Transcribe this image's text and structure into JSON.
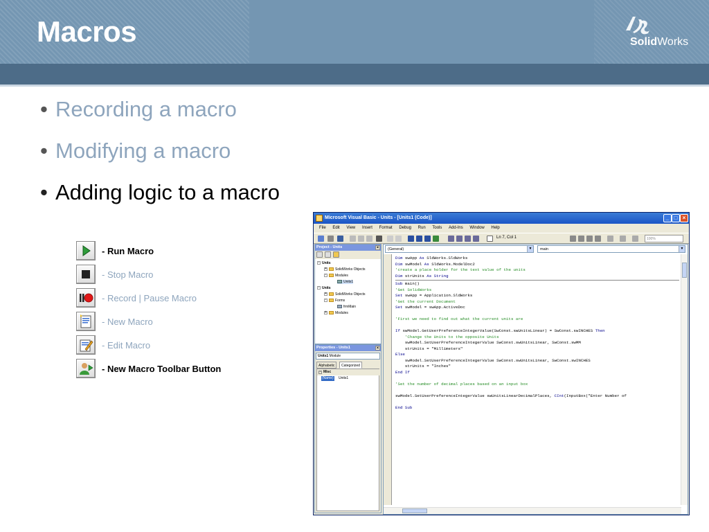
{
  "slide": {
    "title": "Macros",
    "logo_text_bold": "Solid",
    "logo_text_regular": "Works",
    "logo_mark": "3DS"
  },
  "bullets": [
    {
      "text": "Recording a macro",
      "state": "dimmed"
    },
    {
      "text": "Modifying a macro",
      "state": "dimmed"
    },
    {
      "text": "Adding logic to a macro",
      "state": "active"
    }
  ],
  "legend": [
    {
      "icon": "run-macro-icon",
      "label": "- Run Macro",
      "style": "bold"
    },
    {
      "icon": "stop-macro-icon",
      "label": "- Stop Macro",
      "style": "dim"
    },
    {
      "icon": "record-pause-macro-icon",
      "label": "- Record | Pause Macro",
      "style": "dim"
    },
    {
      "icon": "new-macro-icon",
      "label": "- New Macro",
      "style": "dim"
    },
    {
      "icon": "edit-macro-icon",
      "label": "- Edit Macro",
      "style": "dim"
    },
    {
      "icon": "new-macro-toolbar-button-icon",
      "label": "- New Macro Toolbar Button",
      "style": "bold"
    }
  ],
  "vb_window": {
    "title": "Microsoft Visual Basic - Units - [Units1 (Code)]",
    "menu": [
      "File",
      "Edit",
      "View",
      "Insert",
      "Format",
      "Debug",
      "Run",
      "Tools",
      "Add-Ins",
      "Window",
      "Help"
    ],
    "cursor_position": "Ln 7, Col 1",
    "zoom": "100%",
    "project_pane": {
      "title": "Project - Units",
      "tree": [
        {
          "label": "Units",
          "level": 0,
          "bold": true
        },
        {
          "label": "SolidWorks Objects",
          "level": 1
        },
        {
          "label": "Modules",
          "level": 1
        },
        {
          "label": "Units1",
          "level": 2,
          "selected": true
        },
        {
          "label": "Units",
          "level": 0,
          "bold": true
        },
        {
          "label": "SolidWorks Objects",
          "level": 1
        },
        {
          "label": "Forms",
          "level": 1
        },
        {
          "label": "frmMain",
          "level": 2
        },
        {
          "label": "Modules",
          "level": 1
        }
      ]
    },
    "properties_pane": {
      "title": "Properties - Units1",
      "object": "Units1",
      "object_type": "Module",
      "tabs": [
        "Alphabetic",
        "Categorized"
      ],
      "active_tab": "Categorized",
      "category": "Misc",
      "property_name": "(Name)",
      "property_value": "Units1"
    },
    "code_pane": {
      "object_combo": "(General)",
      "proc_combo": "main",
      "lines": [
        {
          "kind": "code",
          "parts": [
            [
              "kw",
              "Dim "
            ],
            [
              "tx",
              "swApp "
            ],
            [
              "kw",
              "As "
            ],
            [
              "tx",
              "SldWorks.SldWorks"
            ]
          ]
        },
        {
          "kind": "code",
          "parts": [
            [
              "kw",
              "Dim "
            ],
            [
              "tx",
              "swModel "
            ],
            [
              "kw",
              "As "
            ],
            [
              "tx",
              "SldWorks.ModelDoc2"
            ]
          ]
        },
        {
          "kind": "code",
          "parts": [
            [
              "cm",
              "'create a place holder for the text value of the units"
            ]
          ]
        },
        {
          "kind": "code",
          "parts": [
            [
              "kw",
              "Dim "
            ],
            [
              "tx",
              "strUnits "
            ],
            [
              "kw",
              "As String"
            ]
          ]
        },
        {
          "kind": "sep"
        },
        {
          "kind": "code",
          "parts": [
            [
              "kw",
              "Sub "
            ],
            [
              "tx",
              "main()"
            ]
          ]
        },
        {
          "kind": "code",
          "parts": [
            [
              "cm",
              "'Get SolidWorks"
            ]
          ]
        },
        {
          "kind": "code",
          "parts": [
            [
              "kw",
              "Set "
            ],
            [
              "tx",
              "swApp = Application.SldWorks"
            ]
          ]
        },
        {
          "kind": "code",
          "parts": [
            [
              "cm",
              "'Get the current Document"
            ]
          ]
        },
        {
          "kind": "code",
          "parts": [
            [
              "kw",
              "Set "
            ],
            [
              "tx",
              "swModel = swApp.ActiveDoc"
            ]
          ]
        },
        {
          "kind": "blank"
        },
        {
          "kind": "code",
          "parts": [
            [
              "cm",
              "'First we need to find out what the current units are"
            ]
          ]
        },
        {
          "kind": "blank"
        },
        {
          "kind": "code",
          "parts": [
            [
              "kw",
              "If "
            ],
            [
              "tx",
              "swModel.GetUserPreferenceIntegerValue(SwConst.swUnitsLinear) = SwConst.swINCHES "
            ],
            [
              "kw",
              "Then"
            ]
          ]
        },
        {
          "kind": "code",
          "parts": [
            [
              "cm",
              "    'Change the Units to the opposite Units"
            ]
          ]
        },
        {
          "kind": "code",
          "parts": [
            [
              "tx",
              "    swModel.SetUserPreferenceIntegerValue SwConst.swUnitsLinear, SwConst.swMM"
            ]
          ]
        },
        {
          "kind": "code",
          "parts": [
            [
              "tx",
              "    strUnits = \"Millimeters\""
            ]
          ]
        },
        {
          "kind": "code",
          "parts": [
            [
              "kw",
              "Else"
            ]
          ]
        },
        {
          "kind": "code",
          "parts": [
            [
              "tx",
              "    swModel.SetUserPreferenceIntegerValue SwConst.swUnitsLinear, SwConst.swINCHES"
            ]
          ]
        },
        {
          "kind": "code",
          "parts": [
            [
              "tx",
              "    strUnits = \"Inches\""
            ]
          ]
        },
        {
          "kind": "code",
          "parts": [
            [
              "kw",
              "End If"
            ]
          ]
        },
        {
          "kind": "blank"
        },
        {
          "kind": "code",
          "parts": [
            [
              "cm",
              "'Set the number of decimal places based on an input box"
            ]
          ]
        },
        {
          "kind": "blank"
        },
        {
          "kind": "code",
          "parts": [
            [
              "tx",
              "swModel.SetUserPreferenceIntegerValue swUnitsLinearDecimalPlaces, "
            ],
            [
              "kw",
              "CInt"
            ],
            [
              "tx",
              "(InputBox(\"Enter Number of"
            ]
          ]
        },
        {
          "kind": "blank"
        },
        {
          "kind": "code",
          "parts": [
            [
              "kw",
              "End Sub"
            ]
          ]
        }
      ]
    }
  },
  "colors": {
    "header": "#7496b2",
    "header_bar": "#4d6c88",
    "bullet_dim": "#8ea5bd",
    "keyword": "#00008b",
    "comment": "#228b22"
  }
}
